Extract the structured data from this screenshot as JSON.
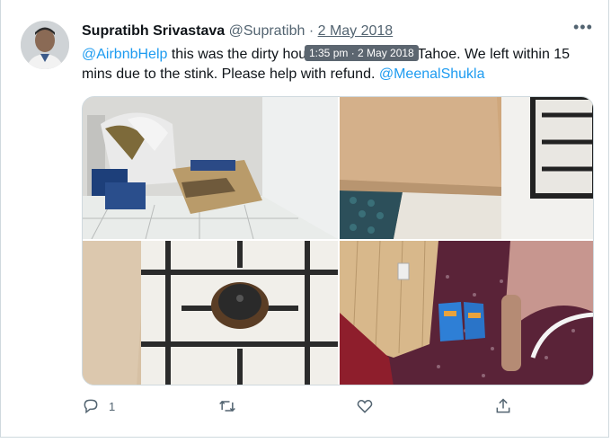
{
  "tweet": {
    "author_name": "Supratibh Srivastava",
    "author_handle": "@Supratibh",
    "separator": "·",
    "date": "2 May 2018",
    "more_label": "•••",
    "tooltip": "1:35 pm · 2 May 2018",
    "text_parts": {
      "mention_1": "@AirbnbHelp",
      "body": " this was the dirty house in South Lake Tahoe. We left within 15 mins due to the stink. Please help with refund. ",
      "mention_2": "@MeenalShukla"
    }
  },
  "media": [
    {
      "icon": "photo-trash-corner"
    },
    {
      "icon": "photo-countertop-stove"
    },
    {
      "icon": "photo-stove-burner"
    },
    {
      "icon": "photo-shoes-carpet"
    }
  ],
  "actions": {
    "reply_count": "1",
    "retweet_count": "",
    "like_count": ""
  },
  "colors": {
    "accent": "#1d9bf0",
    "muted": "#536471",
    "text": "#0f1419"
  }
}
